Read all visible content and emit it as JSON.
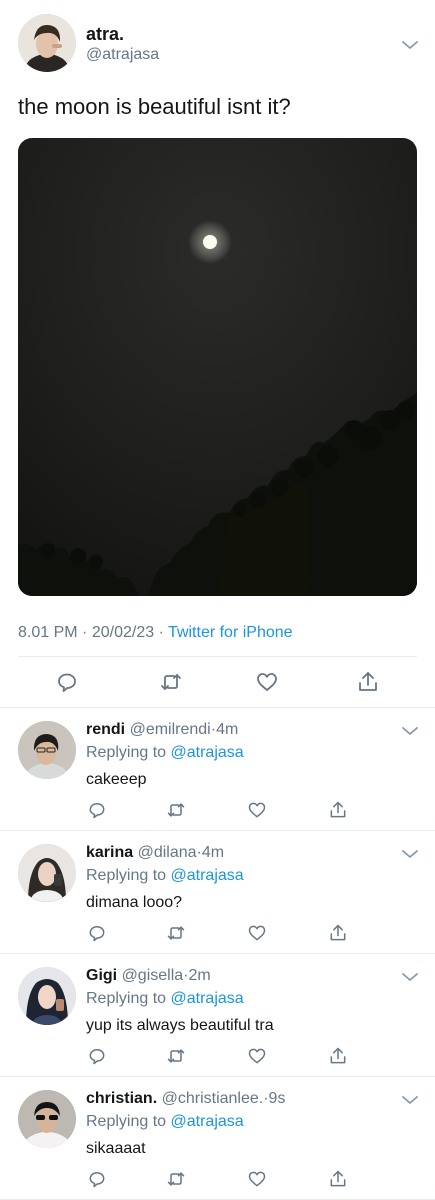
{
  "tweet": {
    "author": {
      "display_name": "atra.",
      "handle": "@atrajasa"
    },
    "text": "the moon is beautiful isnt it?",
    "time": "8.01 PM",
    "date": "20/02/23",
    "separator": "·",
    "source": "Twitter for iPhone",
    "actions": [
      "reply-icon",
      "retweet-icon",
      "like-icon",
      "share-icon"
    ]
  },
  "replies_label": "Replying to",
  "replies": [
    {
      "display_name": "rendi",
      "handle": "@emilrendi",
      "dot": "·",
      "age": "4m",
      "replying_to": "@atrajasa",
      "text": "cakeeep"
    },
    {
      "display_name": "karina",
      "handle": "@dilana",
      "dot": "·",
      "age": "4m",
      "replying_to": "@atrajasa",
      "text": "dimana looo?"
    },
    {
      "display_name": "Gigi",
      "handle": "@gisella",
      "dot": "·",
      "age": "2m",
      "replying_to": "@atrajasa",
      "text": "yup its always beautiful tra"
    },
    {
      "display_name": "christian.",
      "handle": "@christianlee.",
      "dot": "·",
      "age": "9s",
      "replying_to": "@atrajasa",
      "text": "sikaaaat"
    }
  ],
  "colors": {
    "accent": "#1b95e0",
    "muted": "#657786",
    "divider": "#e6ecf0"
  }
}
